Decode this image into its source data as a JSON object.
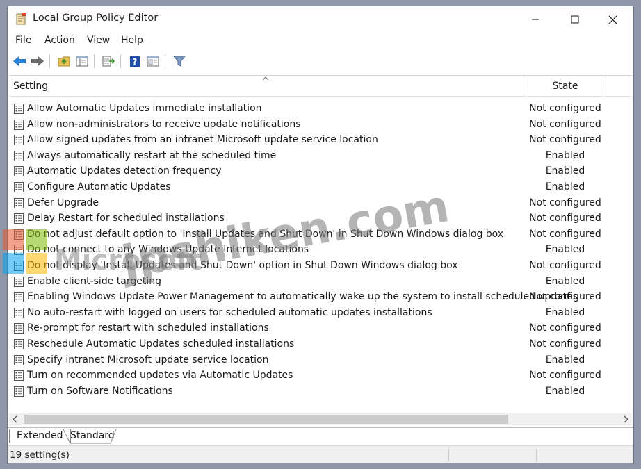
{
  "window": {
    "title": "Local Group Policy Editor"
  },
  "menu": [
    {
      "label": "File"
    },
    {
      "label": "Action"
    },
    {
      "label": "View"
    },
    {
      "label": "Help"
    }
  ],
  "toolbar": {
    "icons": [
      "back-arrow-icon",
      "forward-arrow-icon",
      "up-folder-icon",
      "show-hide-tree-icon",
      "export-list-icon",
      "help-icon",
      "properties-icon",
      "filter-icon"
    ]
  },
  "list": {
    "columns": {
      "setting": "Setting",
      "state": "State"
    },
    "rows": [
      {
        "name": "Allow Automatic Updates immediate installation",
        "state": "Not configured"
      },
      {
        "name": "Allow non-administrators to receive update notifications",
        "state": "Not configured"
      },
      {
        "name": "Allow signed updates from an intranet Microsoft update service location",
        "state": "Not configured"
      },
      {
        "name": "Always automatically restart at the scheduled time",
        "state": "Enabled"
      },
      {
        "name": "Automatic Updates detection frequency",
        "state": "Enabled"
      },
      {
        "name": "Configure Automatic Updates",
        "state": "Enabled"
      },
      {
        "name": "Defer Upgrade",
        "state": "Not configured"
      },
      {
        "name": "Delay Restart for scheduled installations",
        "state": "Not configured"
      },
      {
        "name": "Do not adjust default option to 'Install Updates and Shut Down' in Shut Down Windows dialog box",
        "state": "Not configured"
      },
      {
        "name": "Do not connect to any Windows Update Internet locations",
        "state": "Enabled"
      },
      {
        "name": "Do not display 'Install Updates and Shut Down' option in Shut Down Windows dialog box",
        "state": "Not configured"
      },
      {
        "name": "Enable client-side targeting",
        "state": "Enabled"
      },
      {
        "name": "Enabling Windows Update Power Management to automatically wake up the system to install scheduled updates",
        "state": "Not configured"
      },
      {
        "name": "No auto-restart with logged on users for scheduled automatic updates installations",
        "state": "Enabled"
      },
      {
        "name": "Re-prompt for restart with scheduled installations",
        "state": "Not configured"
      },
      {
        "name": "Reschedule Automatic Updates scheduled installations",
        "state": "Not configured"
      },
      {
        "name": "Specify intranet Microsoft update service location",
        "state": "Enabled"
      },
      {
        "name": "Turn on recommended updates via Automatic Updates",
        "state": "Not configured"
      },
      {
        "name": "Turn on Software Notifications",
        "state": "Enabled"
      }
    ]
  },
  "tabs": [
    {
      "label": "Extended"
    },
    {
      "label": "Standard"
    }
  ],
  "status": {
    "text": "19 setting(s)"
  },
  "watermark": {
    "text1": "Microsoft",
    "text2": "jpshiken.com"
  },
  "colors": {
    "back_arrow": "#2a7fd4",
    "forward_arrow": "#6b6b6b",
    "watermark_red": "#e8572c",
    "watermark_green": "#7fba00",
    "watermark_blue": "#00a4ef",
    "watermark_yellow": "#ffb900"
  }
}
